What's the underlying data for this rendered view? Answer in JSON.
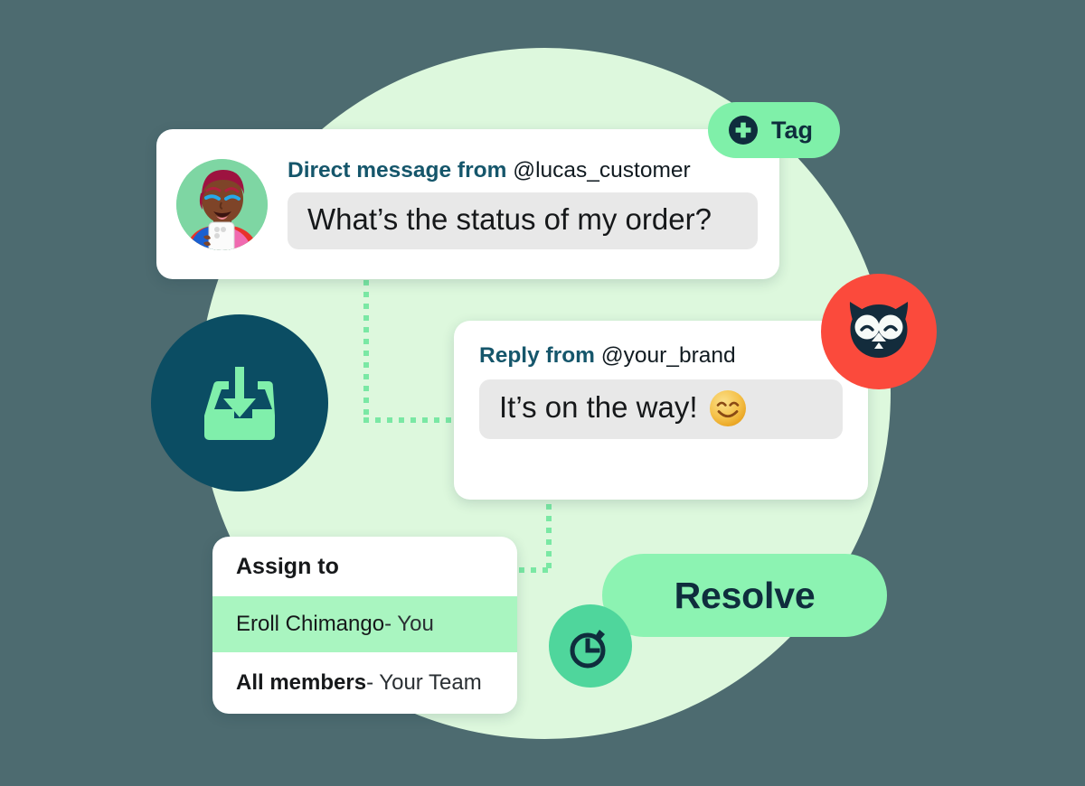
{
  "colors": {
    "page_background": "#4d6b70",
    "hero_circle": "#ddf8dd",
    "connector_dots": "#7ae8a4",
    "tag_pill": "#7ff0a9",
    "resolve_pill": "#8cf3b2",
    "assign_highlight": "#a9f5c0",
    "inbox_badge": "#0b4d63",
    "owl_badge": "#fb4a3c",
    "clock_badge": "#4fd69c",
    "heading_teal": "#15566b",
    "bubble_gray": "#e8e8e8",
    "card_white": "#ffffff"
  },
  "tag_button": {
    "label": "Tag",
    "icon": "plus-circle-icon"
  },
  "direct_message_card": {
    "avatar_icon": "customer-avatar",
    "heading_strong": "Direct message from",
    "heading_handle": "@lucas_customer",
    "message_text": "What’s the status of my order?"
  },
  "reply_card": {
    "heading_strong": "Reply from",
    "heading_handle": "@your_brand",
    "message_text": "It’s on the way!",
    "emoji_icon": "smiling-face-with-smiling-eyes-emoji"
  },
  "assign_card": {
    "title": "Assign to",
    "options": [
      {
        "name": "Eroll Chimango",
        "suffix": " - You",
        "name_bold": false,
        "selected": true
      },
      {
        "name": "All members",
        "suffix": " - Your Team",
        "name_bold": true,
        "selected": false
      }
    ]
  },
  "resolve_button": {
    "label": "Resolve"
  },
  "badges": {
    "inbox": {
      "icon": "inbox-download-icon"
    },
    "brand": {
      "icon": "hootsuite-owl-logo-icon"
    },
    "timer": {
      "icon": "stopwatch-clock-icon"
    }
  }
}
